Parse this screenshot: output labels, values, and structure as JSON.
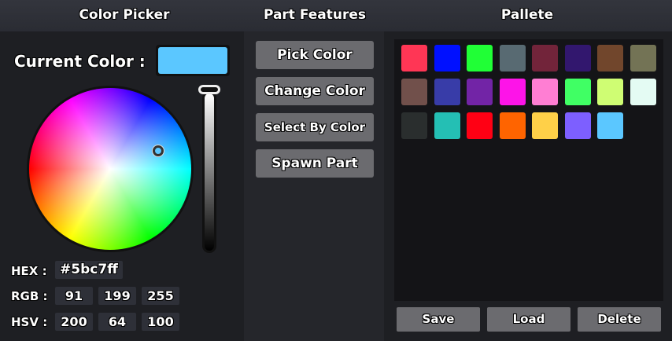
{
  "headers": {
    "color_picker": "Color Picker",
    "part_features": "Part Features",
    "pallete": "Pallete"
  },
  "current": {
    "label": "Current Color :",
    "color": "#5bc7ff"
  },
  "hex": {
    "label": "HEX :",
    "value": "#5bc7ff"
  },
  "rgb": {
    "label": "RGB :",
    "r": "91",
    "g": "199",
    "b": "255"
  },
  "hsv": {
    "label": "HSV :",
    "h": "200",
    "s": "64",
    "v": "100"
  },
  "value_slider": {
    "value_percent": 100
  },
  "features": [
    "Pick Color",
    "Change Color",
    "Select By Color",
    "Spawn Part"
  ],
  "palette": [
    "#ff3655",
    "#0010ff",
    "#20ff36",
    "#586a72",
    "#72243a",
    "#32176e",
    "#71462c",
    "#737355",
    "#71504b",
    "#383ca8",
    "#7224a6",
    "#fd14e8",
    "#ff7ed3",
    "#40ff64",
    "#cffd73",
    "#e4fbf3",
    "#2a2e2e",
    "#24bfb4",
    "#ff0014",
    "#ff6400",
    "#ffd048",
    "#7d5fff",
    "#5bc7ff"
  ],
  "buttons": {
    "save": "Save",
    "load": "Load",
    "delete": "Delete"
  }
}
